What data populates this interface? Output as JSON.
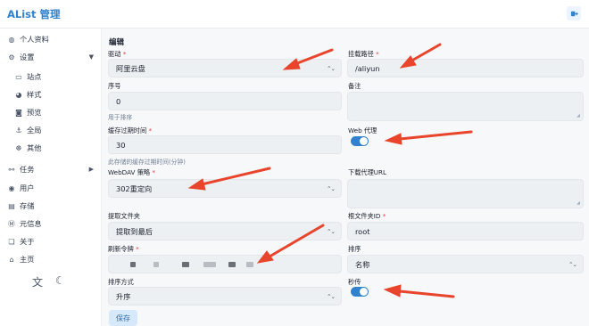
{
  "header": {
    "brand": "AList 管理"
  },
  "sidebar": {
    "items": [
      {
        "label": "个人资料",
        "icon": "user-circle-icon"
      },
      {
        "label": "设置",
        "icon": "gear-icon"
      },
      {
        "label": "站点",
        "icon": "window-icon"
      },
      {
        "label": "样式",
        "icon": "palette-icon"
      },
      {
        "label": "预览",
        "icon": "camera-icon"
      },
      {
        "label": "全局",
        "icon": "anchor-icon"
      },
      {
        "label": "其他",
        "icon": "more-icon"
      },
      {
        "label": "任务",
        "icon": "tasks-icon"
      },
      {
        "label": "用户",
        "icon": "user-icon"
      },
      {
        "label": "存储",
        "icon": "database-icon"
      },
      {
        "label": "元信息",
        "icon": "meta-icon"
      },
      {
        "label": "关于",
        "icon": "info-icon"
      },
      {
        "label": "主页",
        "icon": "home-icon"
      }
    ]
  },
  "form": {
    "heading": "编辑",
    "driver": {
      "label": "驱动",
      "value": "阿里云盘"
    },
    "mount_path": {
      "label": "挂载路径",
      "value": "/aliyun"
    },
    "order": {
      "label": "序号",
      "value": "0",
      "help": "用于排序"
    },
    "remark": {
      "label": "备注",
      "value": ""
    },
    "cache_expiration": {
      "label": "缓存过期时间",
      "value": "30",
      "help": "此存储的缓存过期时间(分钟)"
    },
    "web_proxy": {
      "label": "Web 代理",
      "enabled": true
    },
    "webdav_policy": {
      "label": "WebDAV 策略",
      "value": "302重定向"
    },
    "download_proxy_url": {
      "label": "下载代理URL",
      "value": ""
    },
    "extract_folder": {
      "label": "提取文件夹",
      "value": "提取到最后"
    },
    "root_folder_id": {
      "label": "根文件夹ID",
      "value": "root"
    },
    "refresh_token": {
      "label": "刷新令牌"
    },
    "order_by": {
      "label": "排序",
      "value": "名称"
    },
    "order_direction": {
      "label": "排序方式",
      "value": "升序"
    },
    "rapid_upload": {
      "label": "秒传",
      "enabled": true
    },
    "save_label": "保存"
  },
  "colors": {
    "accent": "#3182ce",
    "arrow": "#e8452c"
  }
}
